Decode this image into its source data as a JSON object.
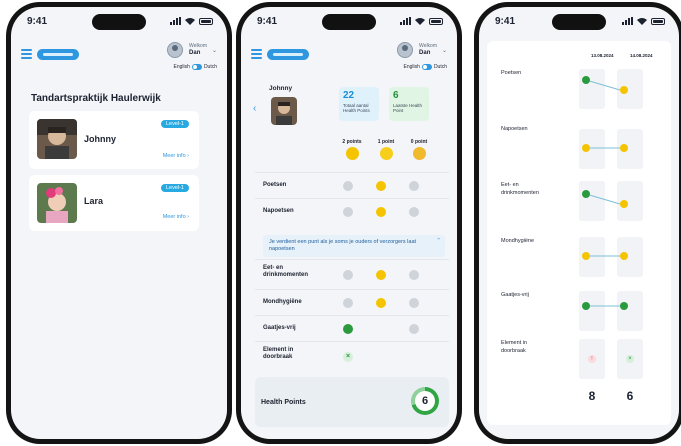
{
  "status": {
    "time": "9:41"
  },
  "header": {
    "welkom": "Welkom",
    "user": "Dan",
    "lang_en": "English",
    "lang_nl": "Dutch"
  },
  "screen1": {
    "title": "Tandartspraktijk Haulerwijk",
    "children": [
      {
        "name": "Johnny",
        "level": "Level-1",
        "more": "Meer info ›"
      },
      {
        "name": "Lara",
        "level": "Level-1",
        "more": "Meer info ›"
      }
    ]
  },
  "screen2": {
    "child_name": "Johnny",
    "stat_total": {
      "value": "22",
      "label": "Totaal aantal Health Points"
    },
    "stat_last": {
      "value": "6",
      "label": "Laatste Health Point"
    },
    "points_headers": [
      "2 points",
      "1 point",
      "0 point"
    ],
    "rows": [
      {
        "label": "Poetsen",
        "selected": 1
      },
      {
        "label": "Napoetsen",
        "selected": 1
      },
      {
        "label": "Eet- en drinkmomenten",
        "selected": 1
      },
      {
        "label": "Mondhygiëne",
        "selected": 1
      },
      {
        "label": "Gaatjes-vrij",
        "selected": 0
      },
      {
        "label": "Element in doorbraak",
        "selected": -1
      }
    ],
    "tip": "Je verdient een punt als je soms je ouders of verzorgers laat napoetsen",
    "health_points_label": "Health Points",
    "health_points_value": "6",
    "health_points_progress": 0.7
  },
  "screen3": {
    "dates": [
      "13.08.2024",
      "14.08.2024"
    ],
    "rows": [
      {
        "label": "Poetsen",
        "a": "green",
        "b": "yellow"
      },
      {
        "label": "Napoetsen",
        "a": "yellow",
        "b": "yellow"
      },
      {
        "label": "Eet- en drinkmomenten",
        "a": "green",
        "b": "yellow"
      },
      {
        "label": "Mondhygiëne",
        "a": "yellow",
        "b": "yellow"
      },
      {
        "label": "Gaatjes-vrij",
        "a": "green",
        "b": "green"
      },
      {
        "label": "Element in doorbraak",
        "a": "red",
        "b": "check"
      }
    ],
    "totals": [
      "8",
      "6"
    ]
  },
  "colors": {
    "accent": "#2f97e0",
    "green": "#2b9a3e",
    "yellow": "#f5c400",
    "background": "#f3f5f8"
  }
}
